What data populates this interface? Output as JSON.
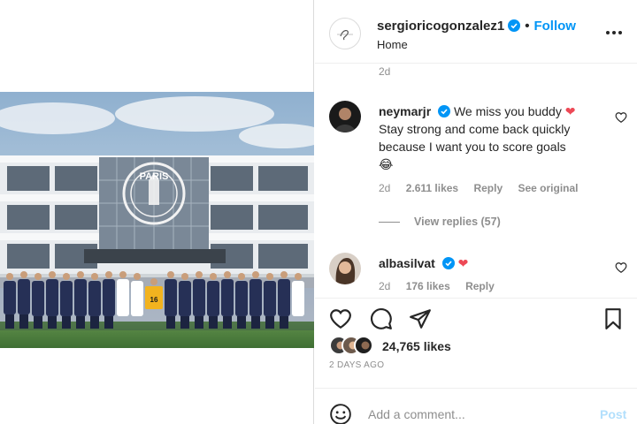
{
  "post": {
    "author": "sergioricogonzalez1",
    "follow_label": "Follow",
    "separator": "•",
    "location": "Home",
    "photo_sign": "PARIS"
  },
  "comments": {
    "previous_timestamp": "2d",
    "items": [
      {
        "user": "neymarjr",
        "text": "We miss you buddy",
        "text_line2": "Stay strong and come back quickly because I want you to score goals",
        "emoji": "😂",
        "time": "2d",
        "likes": "2.611 likes",
        "reply_label": "Reply",
        "see_original": "See original"
      },
      {
        "user": "albasilvat",
        "time": "2d",
        "likes": "176 likes",
        "reply_label": "Reply"
      }
    ],
    "view_replies": "View replies (57)"
  },
  "actions": {
    "likes_count": "24,765 likes",
    "date": "2 DAYS AGO"
  },
  "add_comment": {
    "placeholder": "Add a comment...",
    "post_label": "Post"
  },
  "colors": {
    "accent": "#0095f6",
    "heart": "#ed4956",
    "muted": "#8e8e8e",
    "verified": "#0095f6"
  },
  "icons": {
    "more": "more-dots-icon",
    "heart_outline": "heart-outline-icon",
    "comment": "comment-bubble-icon",
    "share": "paper-plane-icon",
    "save": "bookmark-icon",
    "emoji": "emoji-smile-icon",
    "verified": "verified-badge-icon"
  }
}
